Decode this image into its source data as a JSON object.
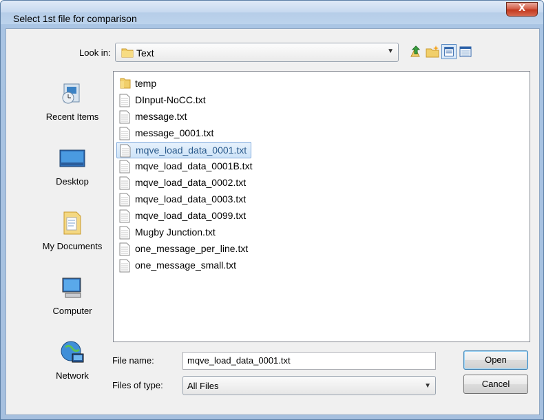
{
  "window": {
    "title": "Select 1st file for comparison",
    "close_label": "X"
  },
  "lookin": {
    "label": "Look in:",
    "value": "Text"
  },
  "places": [
    {
      "label": "Recent Items",
      "icon": "recent-items-icon"
    },
    {
      "label": "Desktop",
      "icon": "desktop-icon"
    },
    {
      "label": "My Documents",
      "icon": "my-documents-icon"
    },
    {
      "label": "Computer",
      "icon": "computer-icon"
    },
    {
      "label": "Network",
      "icon": "network-icon"
    }
  ],
  "files": [
    {
      "name": "temp",
      "type": "folder"
    },
    {
      "name": "DInput-NoCC.txt",
      "type": "text"
    },
    {
      "name": "message.txt",
      "type": "text"
    },
    {
      "name": "message_0001.txt",
      "type": "text"
    },
    {
      "name": "mqve_load_data_0001.txt",
      "type": "text",
      "selected": true
    },
    {
      "name": "mqve_load_data_0001B.txt",
      "type": "text"
    },
    {
      "name": "mqve_load_data_0002.txt",
      "type": "text"
    },
    {
      "name": "mqve_load_data_0003.txt",
      "type": "text"
    },
    {
      "name": "mqve_load_data_0099.txt",
      "type": "text"
    },
    {
      "name": "Mugby Junction.txt",
      "type": "text"
    },
    {
      "name": "one_message_per_line.txt",
      "type": "text"
    },
    {
      "name": "one_message_small.txt",
      "type": "text"
    }
  ],
  "filename": {
    "label": "File name:",
    "value": "mqve_load_data_0001.txt"
  },
  "filetype": {
    "label": "Files of type:",
    "value": "All Files"
  },
  "buttons": {
    "open": "Open",
    "cancel": "Cancel"
  },
  "colors": {
    "selection": "#cde3f8",
    "frame": "#a9c4e3"
  }
}
